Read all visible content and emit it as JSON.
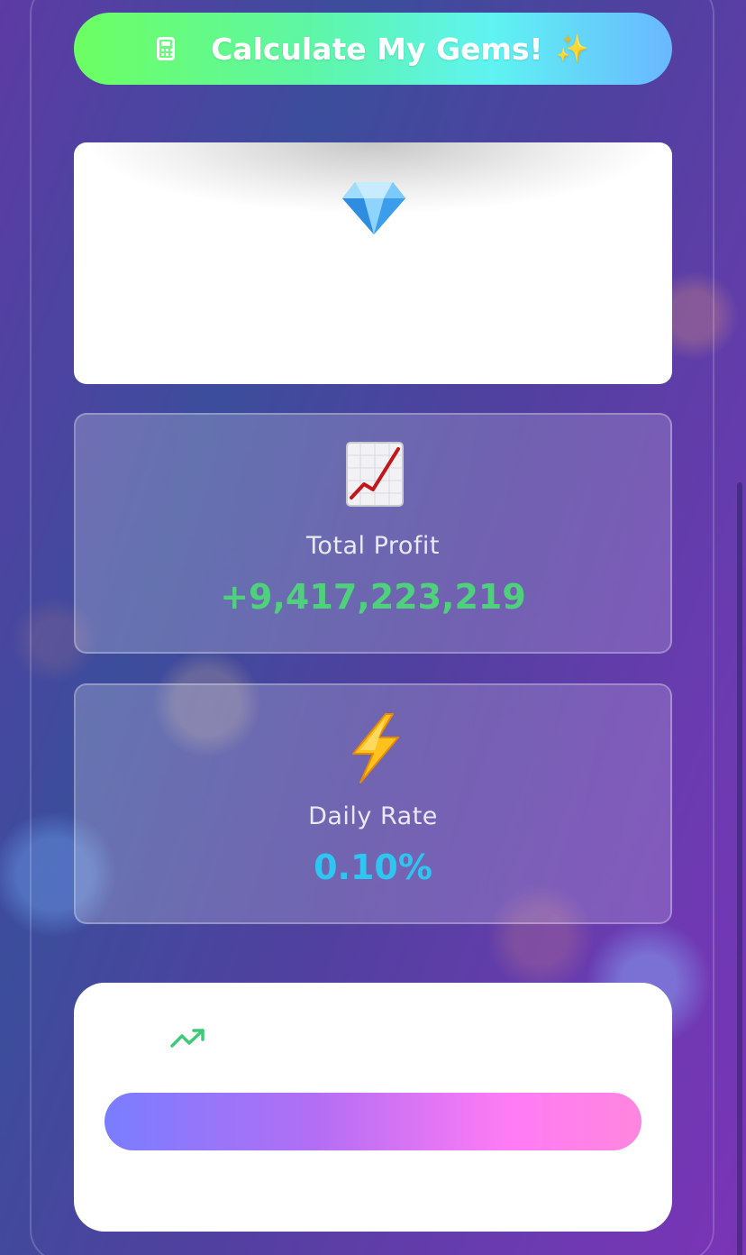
{
  "calculate_button": {
    "label": "Calculate My Gems!",
    "sparkles": "✨",
    "icon": "calculator-icon"
  },
  "gem_card": {
    "icon": "gem-icon"
  },
  "stats": {
    "total_profit": {
      "icon": "chart-increasing-icon",
      "label": "Total Profit",
      "value": "+9,417,223,219",
      "value_color": "#4fd07d"
    },
    "daily_rate": {
      "icon": "lightning-icon",
      "label": "Daily Rate",
      "value": "0.10%",
      "value_color": "#2ec5f0"
    }
  },
  "bottom_card": {
    "icon": "trending-up-icon",
    "bar_colors": [
      "#7a7dff",
      "#ff7bf5"
    ]
  },
  "colors": {
    "button_gradient_start": "#6cff62",
    "button_gradient_end": "#6ab7ff"
  }
}
